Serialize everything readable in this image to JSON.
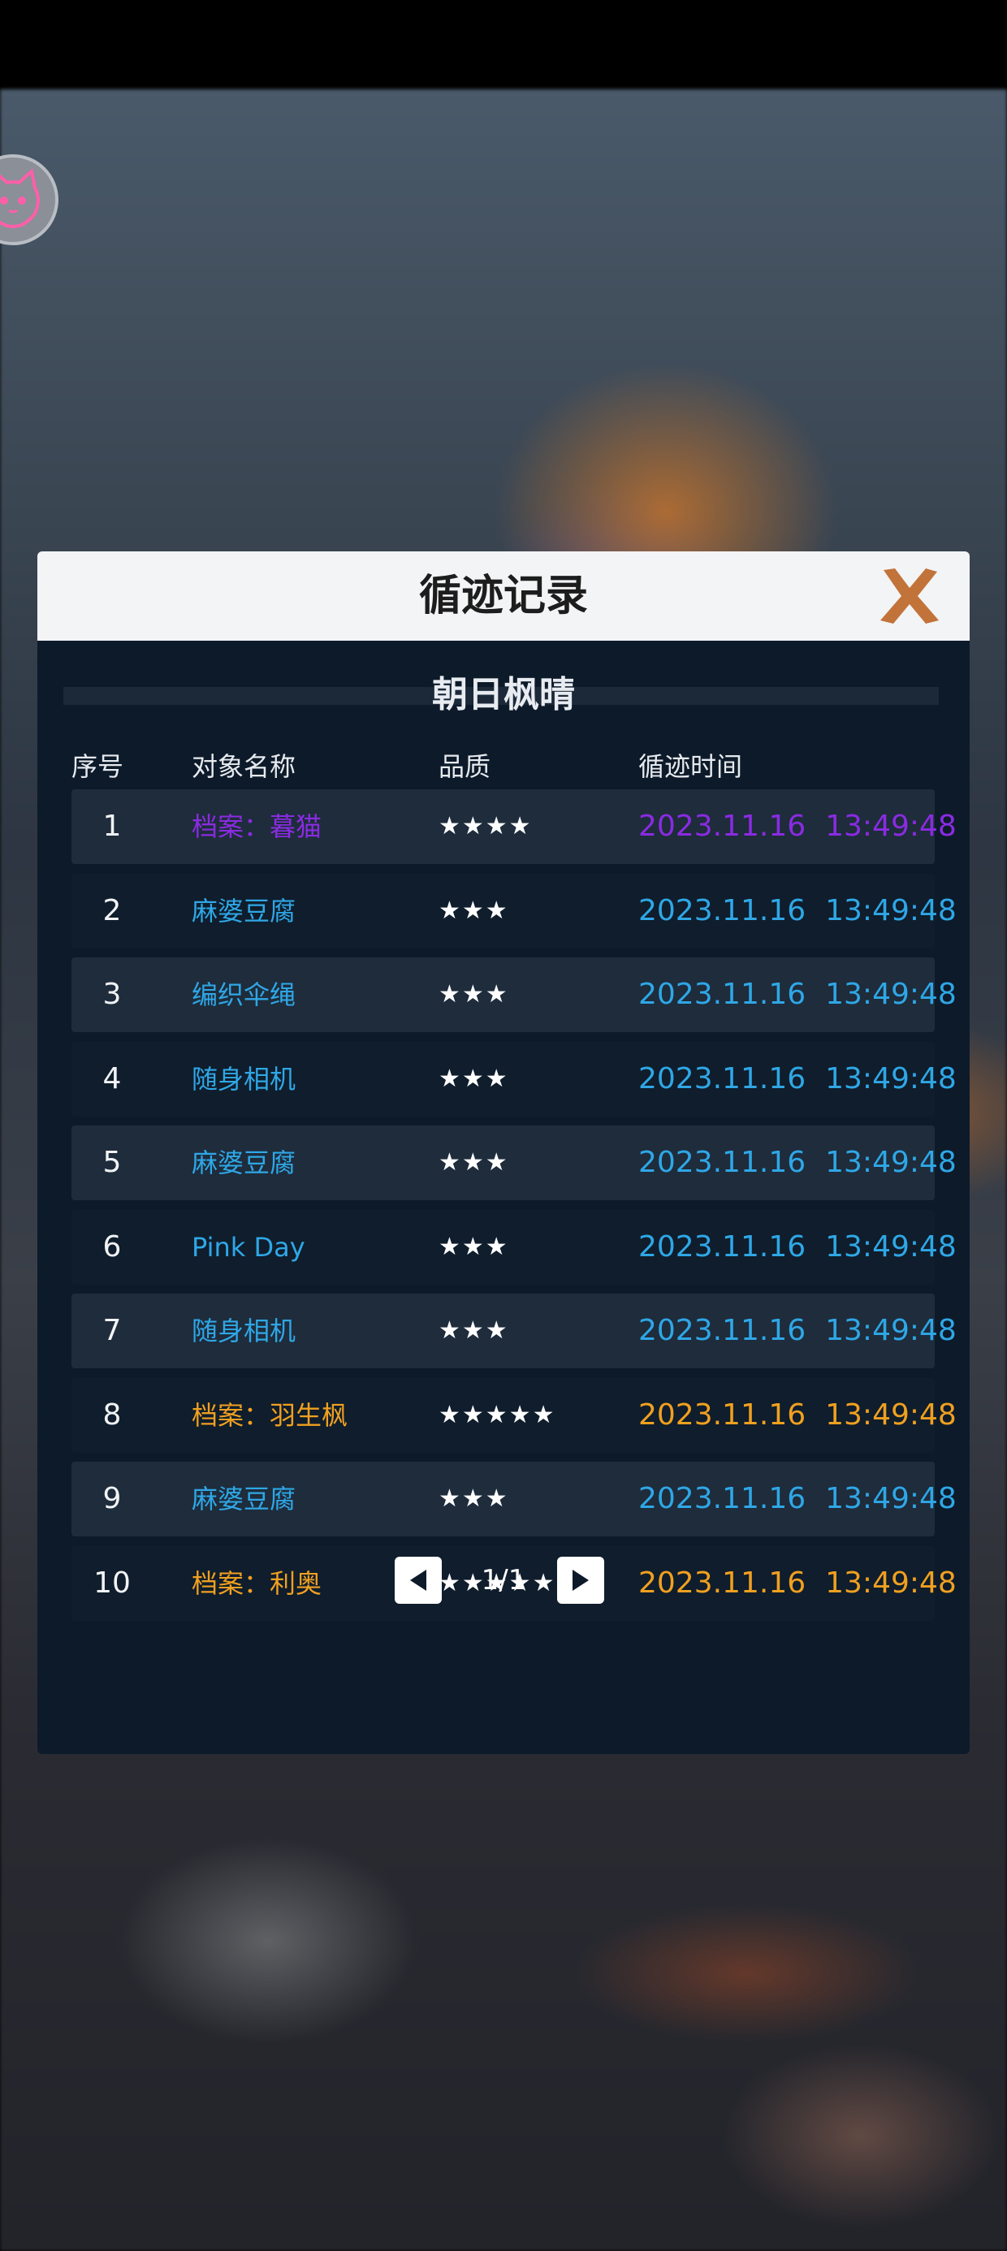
{
  "dialog": {
    "title": "循迹记录",
    "subtitle": "朝日枫晴"
  },
  "columns": {
    "index": "序号",
    "name": "对象名称",
    "quality": "品质",
    "time": "循迹时间"
  },
  "colors": {
    "purple": "#8a2be2",
    "blue": "#2fa7e6",
    "orange": "#f0a020",
    "close": "#c2733a"
  },
  "rows": [
    {
      "index": "1",
      "name": "档案：暮猫",
      "stars": "★★★★",
      "date": "2023.11.16",
      "time": "13:49:48",
      "color": "purple"
    },
    {
      "index": "2",
      "name": "麻婆豆腐",
      "stars": "★★★",
      "date": "2023.11.16",
      "time": "13:49:48",
      "color": "blue"
    },
    {
      "index": "3",
      "name": "编织伞绳",
      "stars": "★★★",
      "date": "2023.11.16",
      "time": "13:49:48",
      "color": "blue"
    },
    {
      "index": "4",
      "name": "随身相机",
      "stars": "★★★",
      "date": "2023.11.16",
      "time": "13:49:48",
      "color": "blue"
    },
    {
      "index": "5",
      "name": "麻婆豆腐",
      "stars": "★★★",
      "date": "2023.11.16",
      "time": "13:49:48",
      "color": "blue"
    },
    {
      "index": "6",
      "name": "Pink Day",
      "stars": "★★★",
      "date": "2023.11.16",
      "time": "13:49:48",
      "color": "blue"
    },
    {
      "index": "7",
      "name": "随身相机",
      "stars": "★★★",
      "date": "2023.11.16",
      "time": "13:49:48",
      "color": "blue"
    },
    {
      "index": "8",
      "name": "档案：羽生枫",
      "stars": "★★★★★",
      "date": "2023.11.16",
      "time": "13:49:48",
      "color": "orange"
    },
    {
      "index": "9",
      "name": "麻婆豆腐",
      "stars": "★★★",
      "date": "2023.11.16",
      "time": "13:49:48",
      "color": "blue"
    },
    {
      "index": "10",
      "name": "档案：利奥",
      "stars": "★★★★★",
      "date": "2023.11.16",
      "time": "13:49:48",
      "color": "orange"
    }
  ],
  "pager": {
    "label": "1/1",
    "prev_icon": "triangle-left-icon",
    "next_icon": "triangle-right-icon"
  },
  "icons": {
    "close": "close-x-icon",
    "avatar": "cat-face-icon"
  }
}
